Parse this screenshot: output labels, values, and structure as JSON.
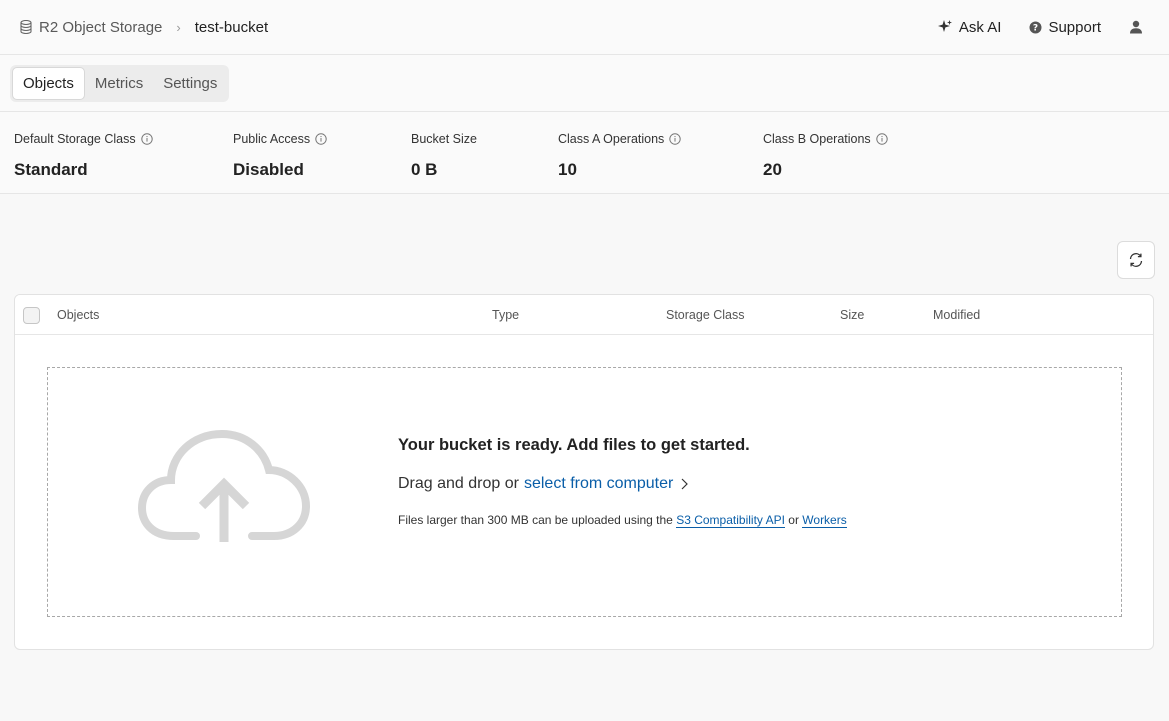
{
  "breadcrumb": {
    "root": "R2 Object Storage",
    "current": "test-bucket"
  },
  "header": {
    "ask_ai": "Ask AI",
    "support": "Support"
  },
  "tabs": [
    {
      "label": "Objects",
      "active": true
    },
    {
      "label": "Metrics",
      "active": false
    },
    {
      "label": "Settings",
      "active": false
    }
  ],
  "stats": [
    {
      "label": "Default Storage Class",
      "value": "Standard",
      "info": true
    },
    {
      "label": "Public Access",
      "value": "Disabled",
      "info": true
    },
    {
      "label": "Bucket Size",
      "value": "0 B",
      "info": false
    },
    {
      "label": "Class A Operations",
      "value": "10",
      "info": true
    },
    {
      "label": "Class B Operations",
      "value": "20",
      "info": true
    }
  ],
  "table": {
    "columns": [
      "Objects",
      "Type",
      "Storage Class",
      "Size",
      "Modified"
    ]
  },
  "dropzone": {
    "title": "Your bucket is ready. Add files to get started.",
    "drag_text": "Drag and drop or",
    "select_link": "select from computer",
    "note_prefix": "Files larger than 300 MB can be uploaded using the",
    "note_link_1": "S3 Compatibility API",
    "note_or": "or",
    "note_link_2": "Workers"
  },
  "colors": {
    "link": "#0a5ea8",
    "cloud": "#d6d6d6"
  }
}
